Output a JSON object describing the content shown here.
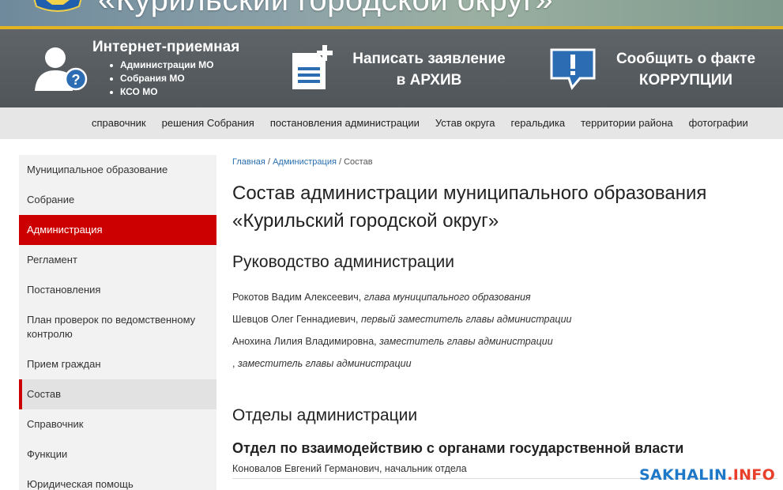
{
  "banner": {
    "title": "«Курильский городской округ»"
  },
  "header": {
    "reception": {
      "title": "Интернет-приемная",
      "items": [
        "Администрации МО",
        "Собрания МО",
        "КСО МО"
      ]
    },
    "write": {
      "line1": "Написать заявление",
      "line2": "в АРХИВ"
    },
    "report": {
      "line1": "Сообщить о факте",
      "line2": "КОРРУПЦИИ"
    }
  },
  "nav": {
    "items": [
      "справочник",
      "решения Собрания",
      "постановления администрации",
      "Устав округа",
      "геральдика",
      "территории района",
      "фотографии"
    ]
  },
  "sidebar": {
    "items": [
      "Муниципальное образование",
      "Собрание",
      "Администрация",
      "Регламент",
      "Постановления",
      "План проверок по ведомственному контролю",
      "Прием граждан",
      "Состав",
      "Справочник",
      "Функции",
      "Юридическая помощь"
    ],
    "active_index": 2,
    "current_index": 7
  },
  "main": {
    "breadcrumb": {
      "home": "Главная",
      "sep": "/",
      "parent": "Администрация",
      "current": "Состав"
    },
    "title": "Состав администрации муниципального образования «Курильский городской округ»",
    "leadership": {
      "heading": "Руководство администрации",
      "people": [
        {
          "name": "Рокотов Вадим Алексеевич,",
          "role": "глава муниципального образования"
        },
        {
          "name": "Шевцов Олег Геннадиевич,",
          "role": "первый заместитель главы администрации"
        },
        {
          "name": "Анохина Лилия Владимировна,",
          "role": "заместитель главы администрации"
        },
        {
          "name": ",",
          "role": "заместитель главы администрации"
        }
      ]
    },
    "departments": {
      "heading": "Отделы администрации",
      "first": {
        "title": "Отдел по взаимодействию с органами государственной власти",
        "head": "Коновалов Евгений Германович, начальник отдела"
      }
    }
  },
  "watermark": {
    "part1": "SAKHALIN",
    "part2": ".INFO"
  },
  "colors": {
    "accent_red": "#cc0000",
    "header_gray": "#575d61",
    "gold": "#e3b422",
    "link_blue": "#2a6fb0",
    "watermark_blue": "#1e78c8",
    "watermark_red": "#e8402a"
  },
  "icons": [
    "coat-of-arms-icon",
    "user-question-icon",
    "document-plus-icon",
    "speech-exclamation-icon"
  ]
}
